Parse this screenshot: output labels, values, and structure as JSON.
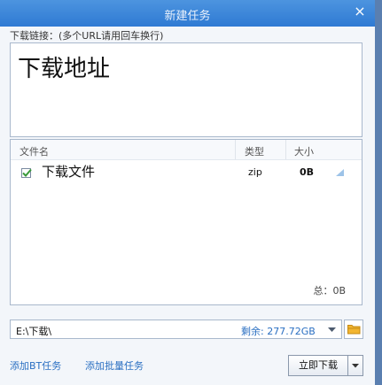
{
  "dialog": {
    "title": "新建任务",
    "close_glyph": "×",
    "url_label": "下载链接：(多个URL请用回车换行)",
    "url_value": "下载地址"
  },
  "file_list": {
    "columns": {
      "name": "文件名",
      "type": "类型",
      "size": "大小"
    },
    "items": [
      {
        "name": "下载文件",
        "type": "zip",
        "size": "0B",
        "checked": true
      }
    ],
    "total": "总：0B"
  },
  "save_path": {
    "value": "E:\\下载\\",
    "free_space": "剩余: 277.72GB"
  },
  "footer": {
    "add_bt": "添加BT任务",
    "add_batch": "添加批量任务",
    "download_now": "立即下载"
  },
  "icons": {
    "close": "close-icon",
    "checkbox": "checkmark-icon",
    "dropdown": "chevron-down-icon",
    "folder": "folder-icon",
    "row_corner": "triangle-icon"
  },
  "colors": {
    "titlebar": "#3784d8",
    "link": "#2a6fc2",
    "check": "#3a9a3a",
    "folder": "#f2b531"
  }
}
